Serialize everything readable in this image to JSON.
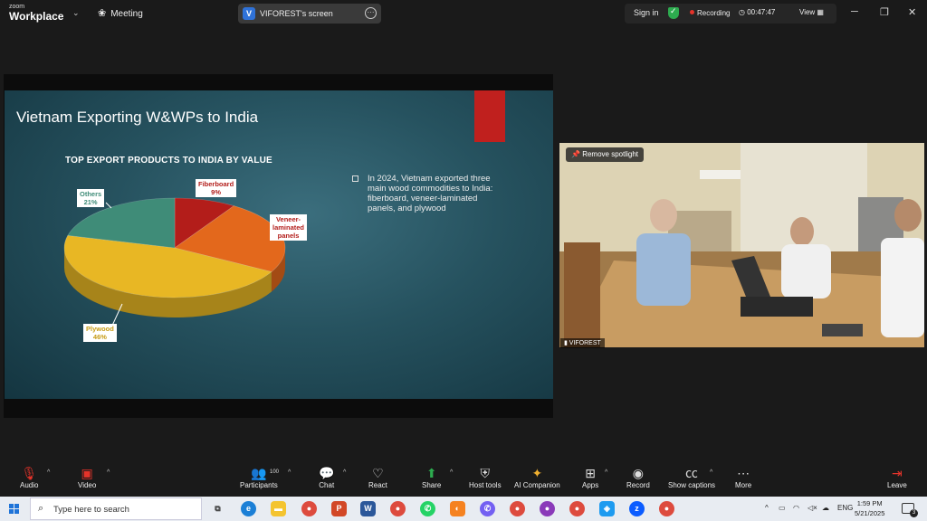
{
  "app": {
    "brand_small": "zoom",
    "brand_big": "Workplace",
    "meeting_label": "Meeting"
  },
  "screen_share": {
    "initial": "V",
    "label": "VIFOREST's screen"
  },
  "top_right": {
    "signin": "Sign in",
    "recording": "Recording",
    "timer": "00:47:47",
    "view": "View"
  },
  "slide": {
    "title": "Vietnam Exporting W&WPs to India",
    "chart_heading": "TOP EXPORT PRODUCTS TO INDIA BY VALUE",
    "bullet": "In 2024, Vietnam exported three main wood commodities to India: fiberboard, veneer-laminated panels, and plywood"
  },
  "chart_data": {
    "type": "pie",
    "title": "TOP EXPORT PRODUCTS TO INDIA BY VALUE",
    "slices": [
      {
        "label": "Fiberboard",
        "value": 9,
        "display": "9%",
        "color": "#b31d1a",
        "label_color": "#b31d1a"
      },
      {
        "label": "Veneer-laminated panels",
        "value": 24,
        "display": "",
        "color": "#e3681c",
        "label_color": "#b31d1a"
      },
      {
        "label": "Plywood",
        "value": 46,
        "display": "46%",
        "color": "#e8b724",
        "label_color": "#c79b14"
      },
      {
        "label": "Others",
        "value": 21,
        "display": "21%",
        "color": "#3f8c78",
        "label_color": "#3f8c78"
      }
    ],
    "label_text": {
      "fiberboard_1": "Fiberboard",
      "fiberboard_2": "9%",
      "veneer_1": "Veneer-",
      "veneer_2": "laminated",
      "veneer_3": "panels",
      "plywood_1": "Plywood",
      "plywood_2": "46%",
      "others_1": "Others",
      "others_2": "21%"
    }
  },
  "video": {
    "spotlight": "Remove spotlight",
    "participant": "VIFOREST"
  },
  "toolbar": {
    "audio": "Audio",
    "video": "Video",
    "participants": "Participants",
    "participants_count": "100",
    "chat": "Chat",
    "react": "React",
    "share": "Share",
    "host_tools": "Host tools",
    "ai_companion": "AI Companion",
    "apps": "Apps",
    "record": "Record",
    "captions": "Show captions",
    "more": "More",
    "leave": "Leave"
  },
  "taskbar": {
    "search_placeholder": "Type here to search",
    "lang": "ENG",
    "time": "1:59 PM",
    "date": "5/21/2025",
    "notif_count": "3"
  }
}
